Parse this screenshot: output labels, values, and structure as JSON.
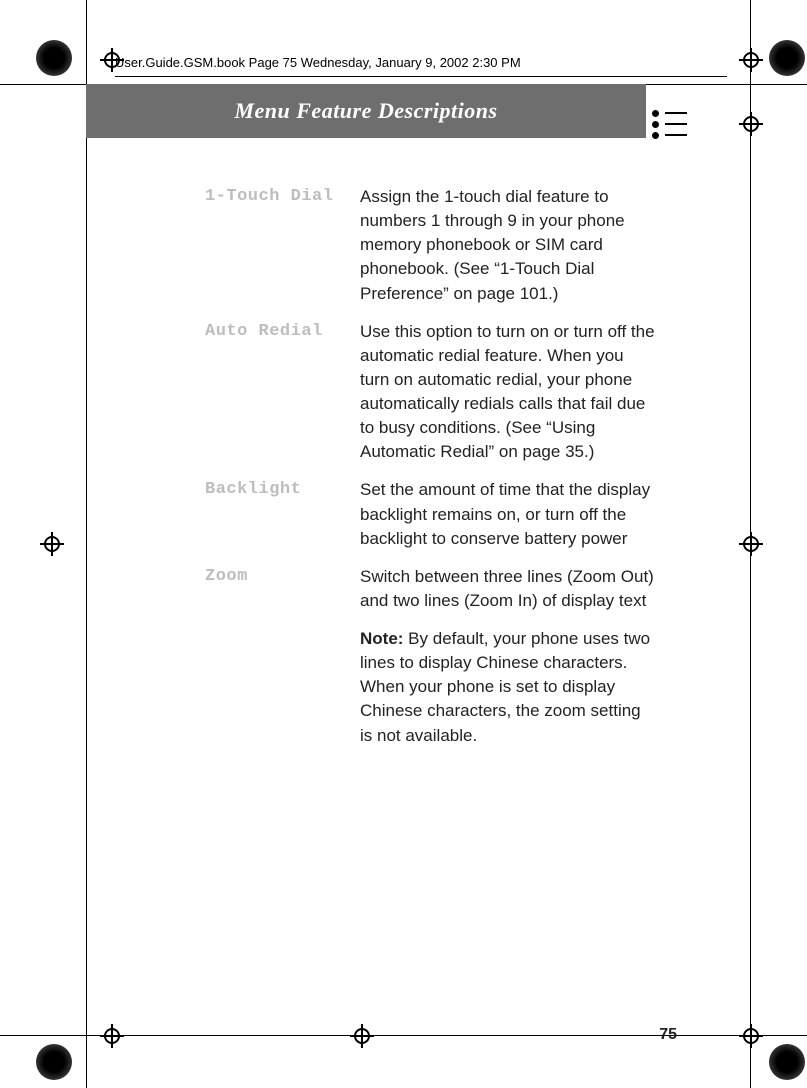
{
  "meta": {
    "running_head": "User.Guide.GSM.book  Page 75  Wednesday, January 9, 2002  2:30 PM",
    "title": "Menu Feature Descriptions",
    "page_number": "75"
  },
  "entries": [
    {
      "term": "1-Touch Dial",
      "desc": "Assign the 1-touch dial feature to numbers 1 through 9 in your phone memory phonebook or SIM card phonebook. (See “1-Touch Dial Preference” on page 101.)"
    },
    {
      "term": "Auto Redial",
      "desc": "Use this option to turn on or turn off the automatic redial feature. When you turn on automatic redial, your phone automatically redials calls that fail due to busy conditions. (See “Using Automatic Redial” on page 35.)"
    },
    {
      "term": "Backlight",
      "desc": "Set the amount of time that the display backlight remains on, or turn off the backlight to conserve battery power"
    },
    {
      "term": "Zoom",
      "desc": "Switch between three lines (Zoom Out) and two lines (Zoom In) of display text"
    }
  ],
  "note": {
    "label": "Note:",
    "text": " By default, your phone uses two lines to display Chinese characters. When your phone is set to display Chinese characters, the zoom setting is not available."
  }
}
